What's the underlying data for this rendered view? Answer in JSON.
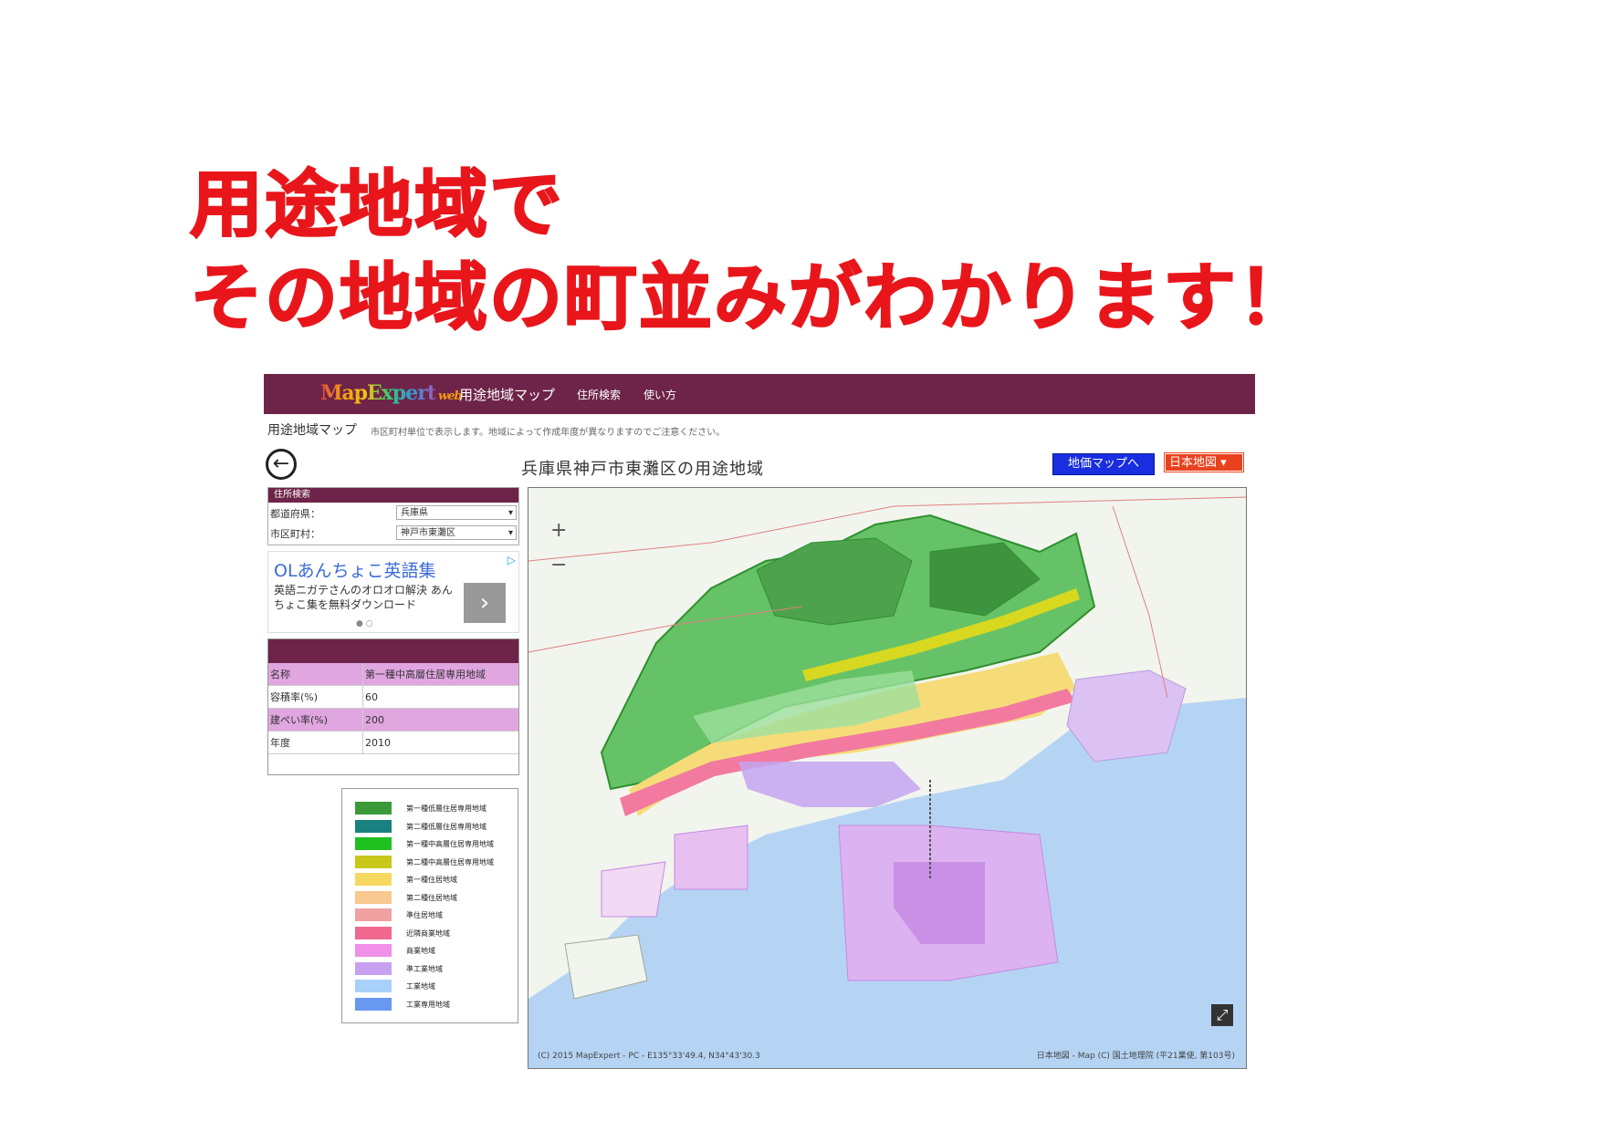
{
  "headline": {
    "line1": "用途地域で",
    "line2": "その地域の町並みがわかります！"
  },
  "app": {
    "logo": "MapExpert",
    "logo_suffix": "web",
    "name": "用途地域マップ",
    "nav": [
      "住所検索",
      "使い方"
    ],
    "subtitle": "用途地域マップ",
    "subnote": "市区町村単位で表示します。地域によって作成年度が異なりますのでご注意ください。",
    "map_title": "兵庫県神戸市東灘区の用途地域",
    "land_price_button": "地価マップへ",
    "basemap_select": "日本地図",
    "back_icon": "arrow-left-circle-icon"
  },
  "search": {
    "header": "住所検索",
    "prefecture_label": "都道府県：",
    "prefecture_value": "兵庫県",
    "city_label": "市区町村：",
    "city_value": "神戸市東灘区"
  },
  "ad": {
    "title": "OLあんちょこ英語集",
    "text": "英語ニガテさんのオロオロ解決 あんちょこ集を無料ダウンロード",
    "dots": "● ○"
  },
  "info": {
    "rows": [
      {
        "k": "名称",
        "v": "第一種中高層住居専用地域"
      },
      {
        "k": "容積率(%)",
        "v": "60"
      },
      {
        "k": "建ぺい率(%)",
        "v": "200"
      },
      {
        "k": "年度",
        "v": "2010"
      }
    ]
  },
  "legend": [
    {
      "name": "第一種低層住居専用地域",
      "color": "#3a9a3a"
    },
    {
      "name": "第二種低層住居専用地域",
      "color": "#1a8080"
    },
    {
      "name": "第一種中高層住居専用地域",
      "color": "#20c020"
    },
    {
      "name": "第二種中高層住居専用地域",
      "color": "#c8c818"
    },
    {
      "name": "第一種住居地域",
      "color": "#f5d860"
    },
    {
      "name": "第二種住居地域",
      "color": "#f8c890"
    },
    {
      "name": "準住居地域",
      "color": "#f0a0a0"
    },
    {
      "name": "近隣商業地域",
      "color": "#f06890"
    },
    {
      "name": "商業地域",
      "color": "#f090e8"
    },
    {
      "name": "準工業地域",
      "color": "#c8a0f0"
    },
    {
      "name": "工業地域",
      "color": "#a8d0f8"
    },
    {
      "name": "工業専用地域",
      "color": "#6898f0"
    }
  ],
  "map": {
    "attribution_left": "(C) 2015 MapExpert - PC - E135°33'49.4, N34°43'30.3",
    "attribution_right": "日本地図 - Map (C) 国土地理院 (平21業使, 第103号)"
  }
}
